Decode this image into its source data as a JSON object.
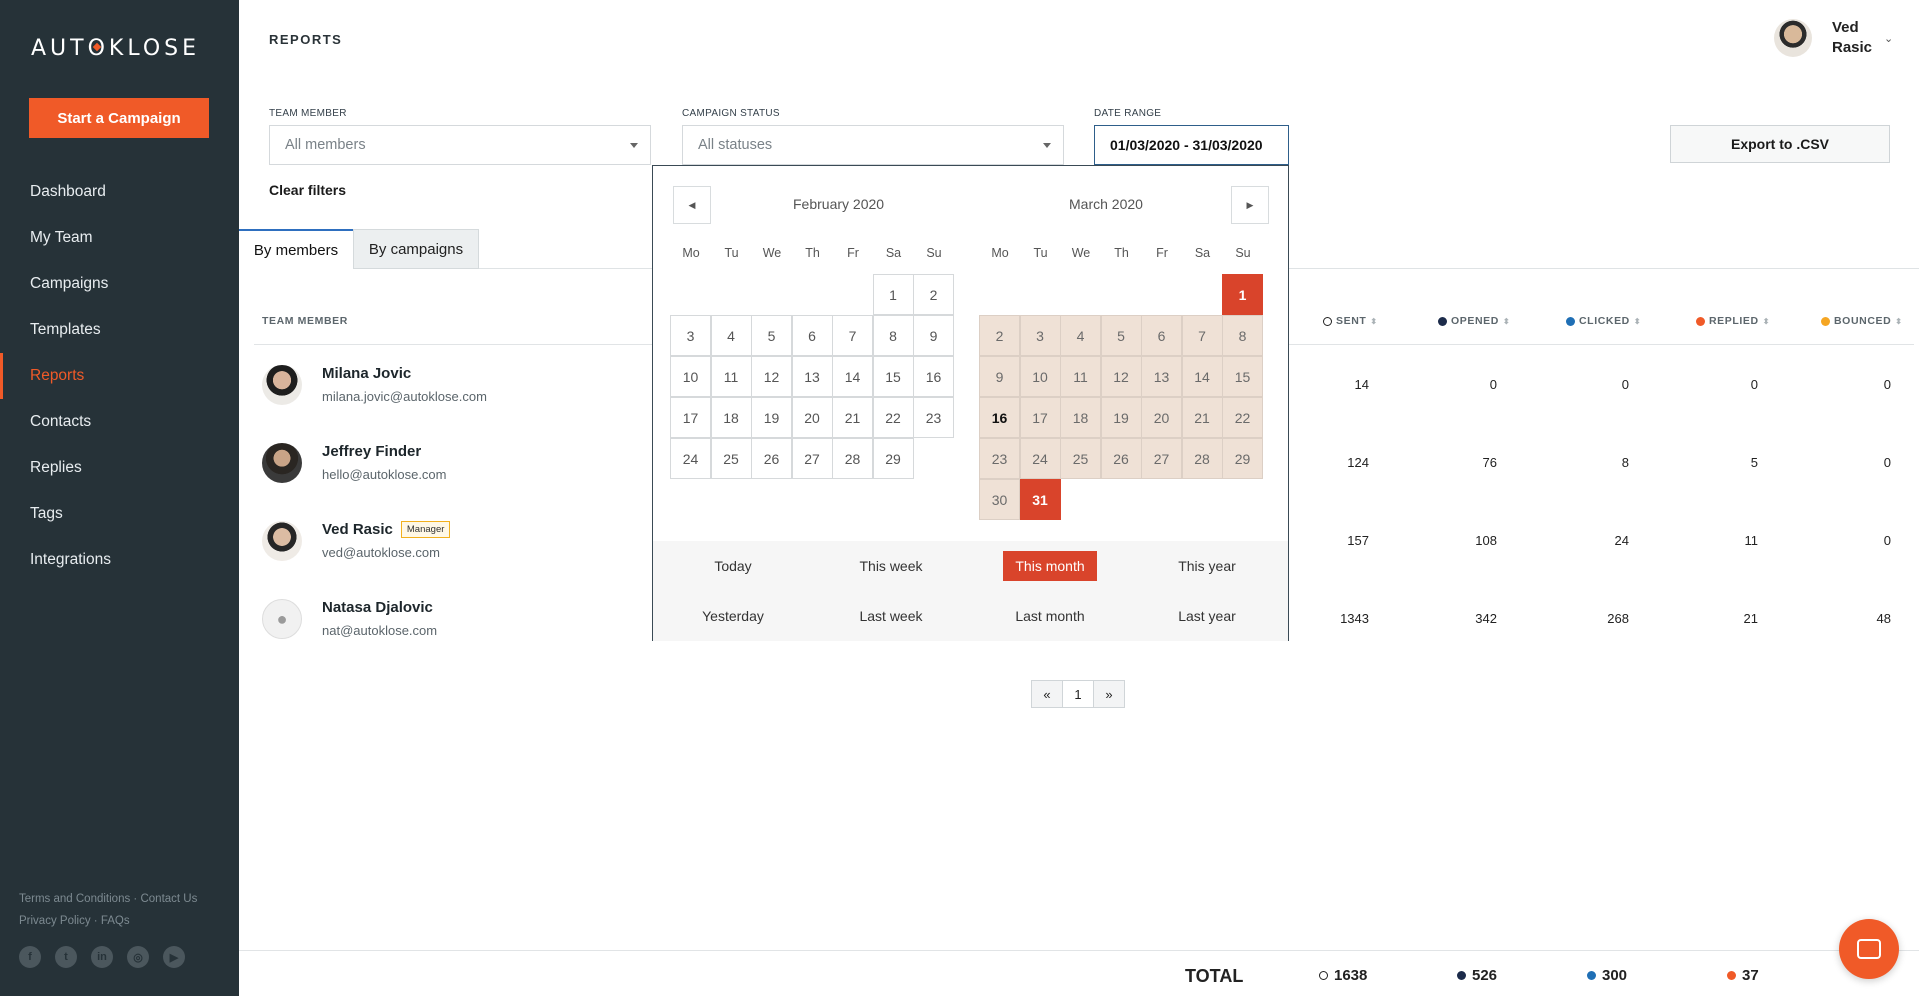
{
  "brand": {
    "logo": "AUTOKLOSE",
    "accent": "#f05a28"
  },
  "sidebar": {
    "cta": "Start a Campaign",
    "items": [
      {
        "label": "Dashboard"
      },
      {
        "label": "My Team"
      },
      {
        "label": "Campaigns"
      },
      {
        "label": "Templates"
      },
      {
        "label": "Reports",
        "active": true
      },
      {
        "label": "Contacts"
      },
      {
        "label": "Replies"
      },
      {
        "label": "Tags"
      },
      {
        "label": "Integrations"
      }
    ],
    "footer": {
      "terms": "Terms and Conditions",
      "contact": "Contact Us",
      "privacy": "Privacy Policy",
      "faqs": "FAQs"
    },
    "socials": [
      "facebook-icon",
      "twitter-icon",
      "linkedin-icon",
      "instagram-icon",
      "youtube-icon"
    ]
  },
  "header": {
    "title": "REPORTS",
    "user_first": "Ved",
    "user_last": "Rasic"
  },
  "filters": {
    "team_label": "TEAM MEMBER",
    "team_value": "All members",
    "status_label": "CAMPAIGN STATUS",
    "status_value": "All statuses",
    "date_label": "DATE RANGE",
    "date_value": "01/03/2020 - 31/03/2020",
    "export": "Export to .CSV",
    "clear": "Clear filters"
  },
  "tabs": {
    "members": "By members",
    "campaigns": "By campaigns"
  },
  "table": {
    "col_member": "TEAM MEMBER",
    "col_sent": "SENT",
    "col_opened": "OPENED",
    "col_clicked": "CLICKED",
    "col_replied": "REPLIED",
    "col_bounced": "BOUNCED",
    "colors": {
      "sent": "#ffffff",
      "opened": "#1c2b4a",
      "clicked": "#1f6fb5",
      "replied": "#f05a28",
      "bounced": "#f5a623"
    },
    "rows": [
      {
        "name": "Milana Jovic",
        "email": "milana.jovic@autoklose.com",
        "badge": "",
        "sent": "14",
        "opened": "0",
        "clicked": "0",
        "replied": "0",
        "bounced": "0"
      },
      {
        "name": "Jeffrey Finder",
        "email": "hello@autoklose.com",
        "badge": "",
        "sent": "124",
        "opened": "76",
        "clicked": "8",
        "replied": "5",
        "bounced": "0"
      },
      {
        "name": "Ved Rasic",
        "email": "ved@autoklose.com",
        "badge": "Manager",
        "sent": "157",
        "opened": "108",
        "clicked": "24",
        "replied": "11",
        "bounced": "0"
      },
      {
        "name": "Natasa Djalovic",
        "email": "nat@autoklose.com",
        "badge": "",
        "sent": "1343",
        "opened": "342",
        "clicked": "268",
        "replied": "21",
        "bounced": "48"
      }
    ]
  },
  "pagination": {
    "prev": "«",
    "page": "1",
    "next": "»"
  },
  "totals": {
    "label": "TOTAL",
    "sent": "1638",
    "opened": "526",
    "clicked": "300",
    "replied": "37"
  },
  "datepicker": {
    "left_month": "February 2020",
    "right_month": "March 2020",
    "weekdays": [
      "Mo",
      "Tu",
      "We",
      "Th",
      "Fr",
      "Sa",
      "Su"
    ],
    "presets": {
      "today": "Today",
      "this_week": "This week",
      "this_month": "This month",
      "this_year": "This year",
      "yesterday": "Yesterday",
      "last_week": "Last week",
      "last_month": "Last month",
      "last_year": "Last year"
    },
    "selected_preset": "This month",
    "range_start": 1,
    "range_end": 31,
    "today_day": 16
  }
}
